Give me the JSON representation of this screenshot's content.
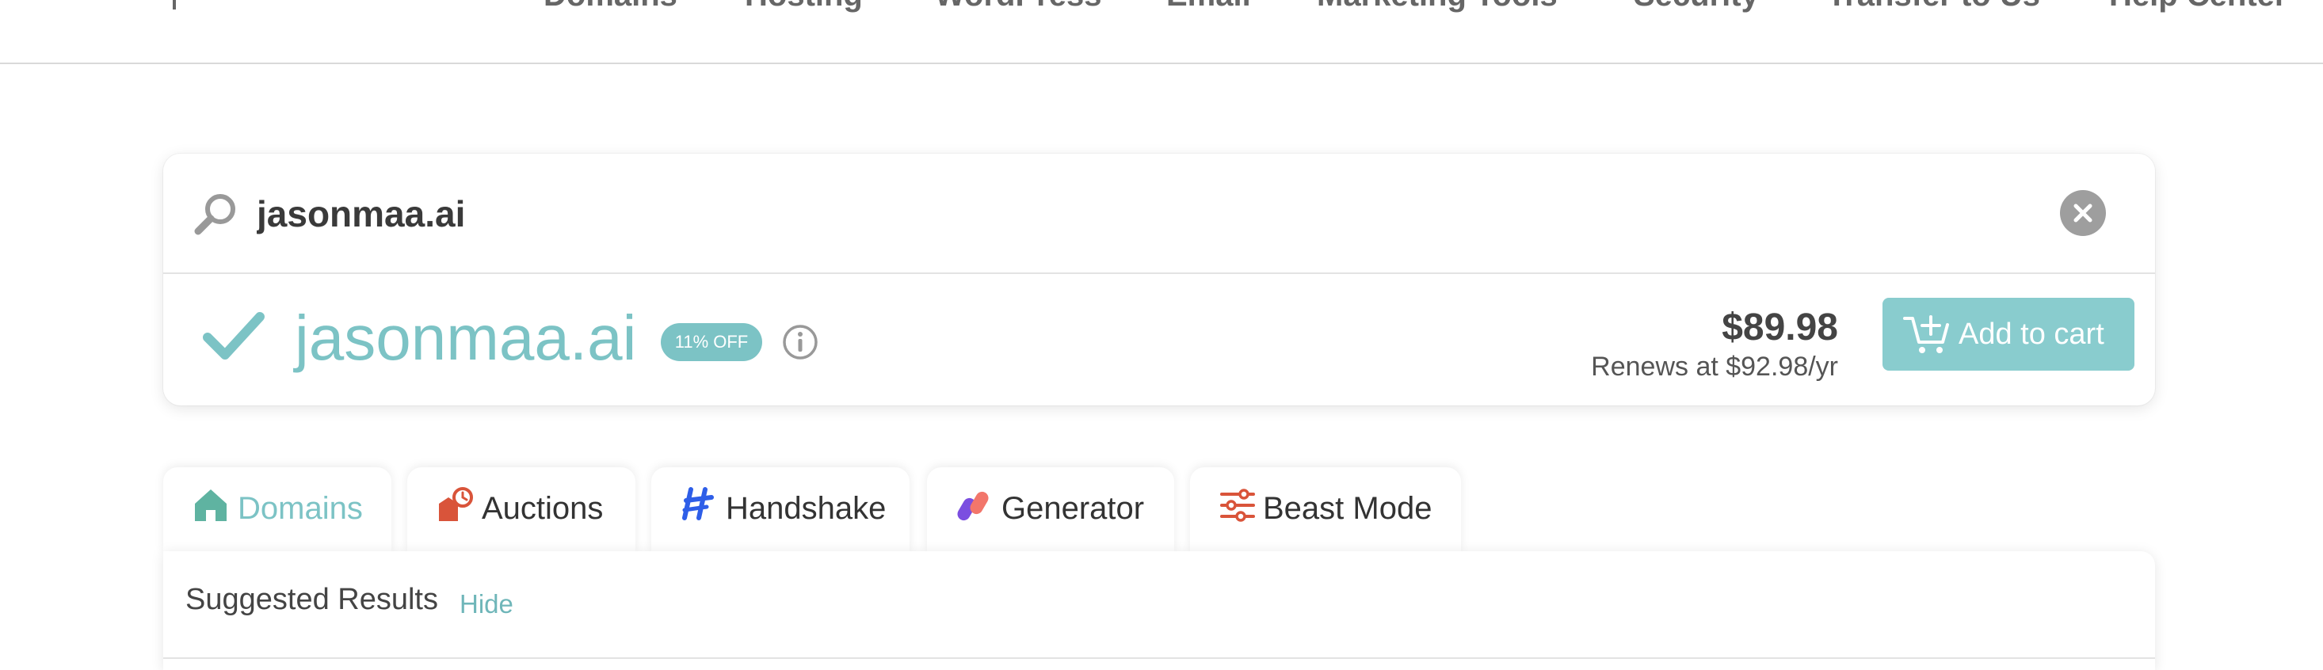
{
  "nav": {
    "items": [
      "Domains",
      "Hosting",
      "WordPress",
      "Email",
      "Marketing Tools",
      "Security",
      "Transfer to Us",
      "Help Center"
    ]
  },
  "search": {
    "value": "jasonmaa.ai",
    "placeholder": ""
  },
  "result": {
    "domain": "jasonmaa.ai",
    "badge": "11% OFF",
    "price": "$89.98",
    "renews": "Renews at $92.98/yr",
    "add_to_cart_label": "Add to cart"
  },
  "tabs": [
    {
      "label": "Domains",
      "icon": "house-icon",
      "active": true
    },
    {
      "label": "Auctions",
      "icon": "auction-clock-icon",
      "active": false
    },
    {
      "label": "Handshake",
      "icon": "handshake-logo-icon",
      "active": false
    },
    {
      "label": "Generator",
      "icon": "generator-pills-icon",
      "active": false
    },
    {
      "label": "Beast Mode",
      "icon": "sliders-icon",
      "active": false
    }
  ],
  "results_panel": {
    "title": "Suggested Results",
    "hide_label": "Hide"
  },
  "colors": {
    "accent": "#7cc3c5",
    "button": "#89ccce",
    "auction_red": "#d9543a",
    "text_dark": "#333333"
  }
}
